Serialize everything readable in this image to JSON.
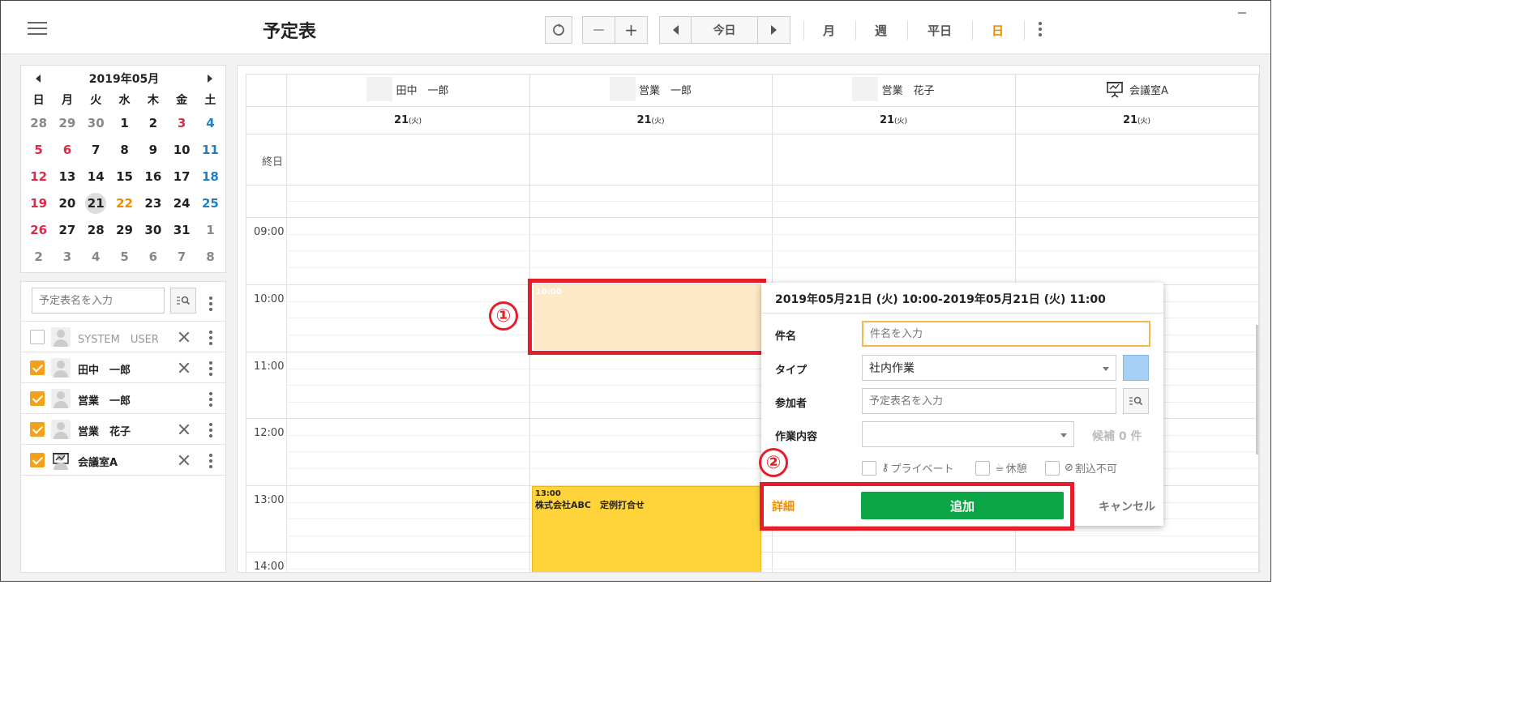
{
  "app": {
    "title": "予定表"
  },
  "toolbar": {
    "minus": "—",
    "plus": "+",
    "today": "今日",
    "views": [
      "月",
      "週",
      "平日",
      "日"
    ],
    "active_view": "日"
  },
  "mini_calendar": {
    "month": "2019年05月",
    "weekdays": [
      "日",
      "月",
      "火",
      "水",
      "木",
      "金",
      "土"
    ],
    "weeks": [
      [
        "28",
        "29",
        "30",
        "1",
        "2",
        "3",
        "4"
      ],
      [
        "5",
        "6",
        "7",
        "8",
        "9",
        "10",
        "11"
      ],
      [
        "12",
        "13",
        "14",
        "15",
        "16",
        "17",
        "18"
      ],
      [
        "19",
        "20",
        "21",
        "22",
        "23",
        "24",
        "25"
      ],
      [
        "26",
        "27",
        "28",
        "29",
        "30",
        "31",
        "1"
      ],
      [
        "2",
        "3",
        "4",
        "5",
        "6",
        "7",
        "8"
      ]
    ]
  },
  "resources": {
    "search_placeholder": "予定表名を入力",
    "items": [
      {
        "name": "SYSTEM　USER",
        "checked": false
      },
      {
        "name": "田中　一郎",
        "checked": true
      },
      {
        "name": "営業　一郎",
        "checked": true
      },
      {
        "name": "営業　花子",
        "checked": true
      },
      {
        "name": "会議室A",
        "checked": true
      }
    ]
  },
  "calendar": {
    "columns": [
      {
        "name": "田中　一郎",
        "date": "21",
        "dow": "(火)"
      },
      {
        "name": "営業　一郎",
        "date": "21",
        "dow": "(火)"
      },
      {
        "name": "営業　花子",
        "date": "21",
        "dow": "(火)"
      },
      {
        "name": "会議室A",
        "date": "21",
        "dow": "(火)"
      }
    ],
    "allday_label": "終日",
    "times": [
      "09:00",
      "10:00",
      "11:00",
      "12:00",
      "13:00",
      "14:00"
    ],
    "events": [
      {
        "time": "10:00",
        "title": "",
        "color": "#fde8c8"
      },
      {
        "time": "13:00",
        "title": "株式会社ABC　定例打合せ",
        "color": "#ffd43b"
      }
    ]
  },
  "annotations": {
    "one": "①",
    "two": "②",
    "color": "#e61e2a"
  },
  "popup": {
    "header": "2019年05月21日 (火) 10:00-2019年05月21日 (火) 11:00",
    "subject_label": "件名",
    "subject_placeholder": "件名を入力",
    "type_label": "タイプ",
    "type_value": "社内作業",
    "type_color": "#a7d0f7",
    "participants_label": "参加者",
    "participants_placeholder": "予定表名を入力",
    "work_label": "作業内容",
    "work_value": "",
    "candidates": "候補 0 件",
    "opt_private": "プライベート",
    "opt_break": "休憩",
    "opt_no_interrupt": "割込不可",
    "detail": "詳細",
    "add": "追加",
    "cancel": "キャンセル"
  }
}
